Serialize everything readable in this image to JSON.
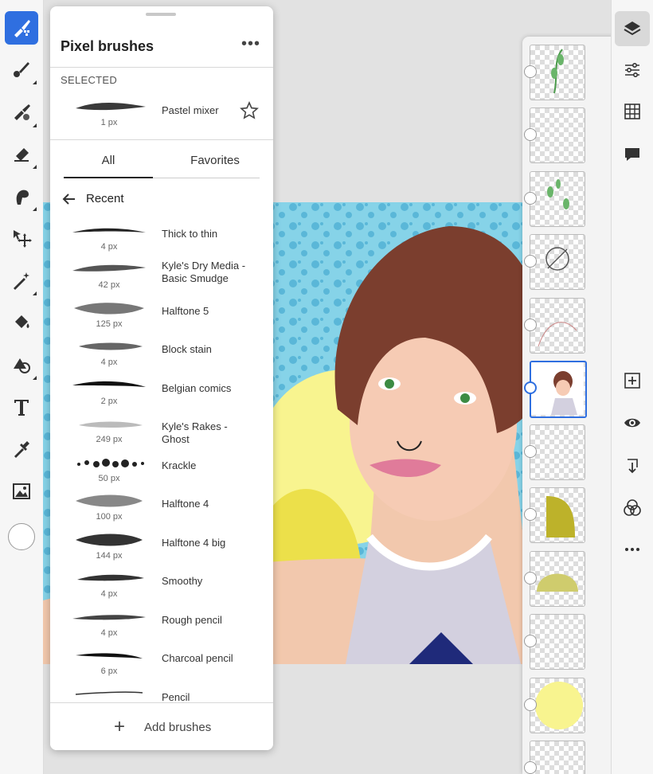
{
  "brush_panel": {
    "title": "Pixel brushes",
    "more_icon": "ellipsis-icon",
    "selected_section_label": "SELECTED",
    "selected_brush": {
      "name": "Pastel mixer",
      "size": "1 px"
    },
    "tabs": [
      {
        "label": "All",
        "active": true
      },
      {
        "label": "Favorites",
        "active": false
      }
    ],
    "recent_label": "Recent",
    "brushes": [
      {
        "name": "Thick to thin",
        "size": "4 px"
      },
      {
        "name": "Kyle's Dry Media - Basic Smudge",
        "size": "42 px"
      },
      {
        "name": "Halftone 5",
        "size": "125 px"
      },
      {
        "name": "Block stain",
        "size": "4 px"
      },
      {
        "name": "Belgian comics",
        "size": "2 px"
      },
      {
        "name": "Kyle's Rakes - Ghost",
        "size": "249 px"
      },
      {
        "name": "Krackle",
        "size": "50 px"
      },
      {
        "name": "Halftone 4",
        "size": "100 px"
      },
      {
        "name": "Halftone 4 big",
        "size": "144 px"
      },
      {
        "name": "Smoothy",
        "size": "4 px"
      },
      {
        "name": "Rough pencil",
        "size": "4 px"
      },
      {
        "name": "Charcoal pencil",
        "size": "6 px"
      },
      {
        "name": "Pencil",
        "size": ""
      }
    ],
    "add_brushes_label": "Add brushes"
  },
  "left_toolbar": {
    "tools": [
      "pixel-brush-icon",
      "live-brush-icon",
      "mixer-brush-icon",
      "eraser-icon",
      "smudge-icon",
      "move-icon",
      "magic-wand-icon",
      "fill-icon",
      "shape-icon",
      "text-icon",
      "eyedropper-icon",
      "image-icon"
    ],
    "active_tool": "pixel-brush-icon",
    "color": "#ffffff"
  },
  "right_toolbar": {
    "tools": [
      "layers-icon",
      "adjustments-icon",
      "grid-icon",
      "comment-icon",
      "add-layer-icon",
      "visibility-icon",
      "merge-down-icon",
      "blend-modes-icon",
      "more-icon"
    ],
    "active_tool": "layers-icon"
  },
  "colors": {
    "accent": "#2f6fe0",
    "canvas_bg": "#86d3e8"
  }
}
